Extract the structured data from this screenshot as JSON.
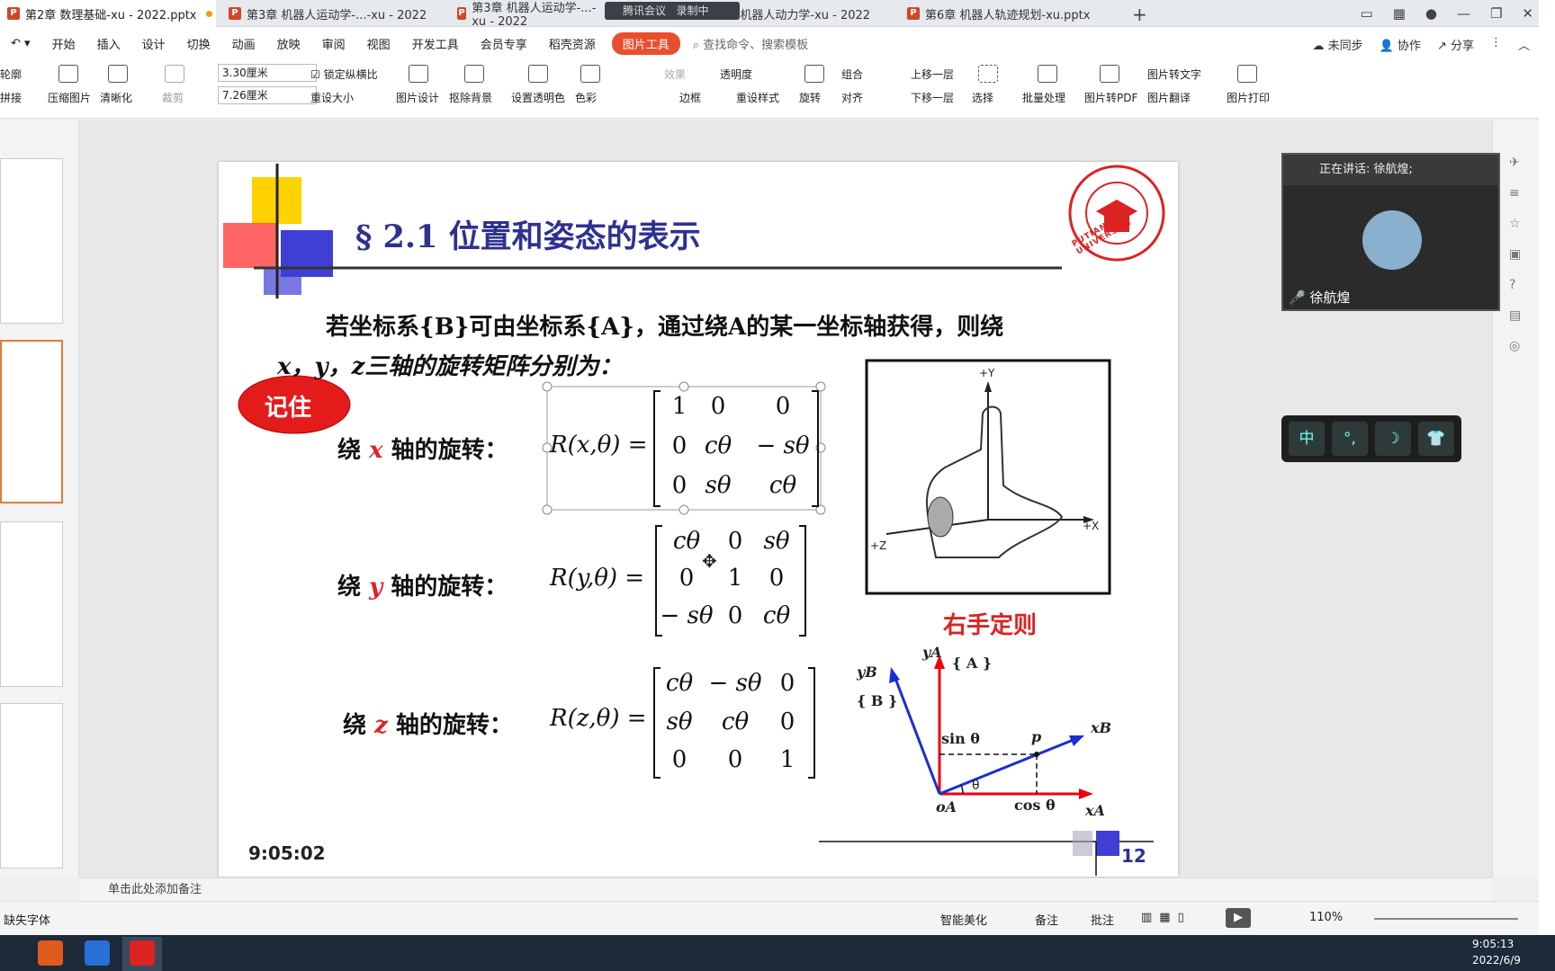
{
  "tabs": [
    {
      "label": "第2章 数理基础-xu - 2022.pptx",
      "active": true
    },
    {
      "label": "第3章 机器人运动学-...-xu - 2022",
      "active": false
    },
    {
      "label": "第3章 机器人运动学-...-xu - 2022",
      "active": false
    },
    {
      "label": "第5章 机器人动力学-xu - 2022",
      "active": false
    },
    {
      "label": "第6章 机器人轨迹规划-xu.pptx",
      "active": false
    }
  ],
  "meeting": {
    "label": "腾讯会议",
    "recording": "录制中"
  },
  "menu": [
    "开始",
    "插入",
    "设计",
    "切换",
    "动画",
    "放映",
    "审阅",
    "视图",
    "开发工具",
    "会员专享",
    "稻壳资源"
  ],
  "menu_active": "图片工具",
  "search_placeholder": "查找命令、搜索模板",
  "menu_right": [
    "未同步",
    "协作",
    "分享"
  ],
  "ribbon": {
    "items": [
      "轮廓",
      "拼接",
      "压缩图片",
      "清晰化",
      "裁剪",
      "锁定纵横比",
      "重设大小",
      "图片设计",
      "抠除背景",
      "设置透明色",
      "色彩",
      "效果",
      "透明度",
      "边框",
      "重设样式",
      "旋转",
      "组合",
      "对齐",
      "上移一层",
      "下移一层",
      "选择",
      "批量处理",
      "图片转PDF",
      "图片转文字",
      "图片翻译",
      "图片打印"
    ],
    "width_value": "3.30厘米",
    "height_value": "7.26厘米"
  },
  "slide": {
    "title": "§ 2.1 位置和姿态的表示",
    "para1": "若坐标系{B}可由坐标系{A}，通过绕A的某一坐标轴获得，则绕",
    "para2": "x，y，z三轴的旋转矩阵分别为：",
    "badge": "记住",
    "rot_x": {
      "pre": "绕",
      "axis": "x",
      "post": "轴的旋转：",
      "lhs": "R(x,θ) =",
      "m": [
        [
          "1",
          "0",
          "0"
        ],
        [
          "0",
          "cθ",
          "− sθ"
        ],
        [
          "0",
          "sθ",
          "cθ"
        ]
      ]
    },
    "rot_y": {
      "pre": "绕",
      "axis": "y",
      "post": "轴的旋转：",
      "lhs": "R(y,θ) =",
      "m": [
        [
          "cθ",
          "0",
          "sθ"
        ],
        [
          "0",
          "1",
          "0"
        ],
        [
          "− sθ",
          "0",
          "cθ"
        ]
      ]
    },
    "rot_z": {
      "pre": "绕",
      "axis": "z",
      "post": "轴的旋转：",
      "lhs": "R(z,θ) =",
      "m": [
        [
          "cθ",
          "− sθ",
          "0"
        ],
        [
          "sθ",
          "cθ",
          "0"
        ],
        [
          "0",
          "0",
          "1"
        ]
      ]
    },
    "hand_caption": "右手定则",
    "hand_labels": {
      "y": "+Y",
      "x": "+X",
      "z": "+Z"
    },
    "diagram": {
      "yA": "yA",
      "yB": "yB",
      "A": "{ A }",
      "B": "{ B }",
      "sin": "sin θ",
      "cos": "cos θ",
      "p": "p",
      "xB": "xB",
      "xA": "xA",
      "oA": "oA",
      "theta": "θ"
    },
    "clock": "9:05:02",
    "page": "12",
    "university_text": "PUTIAN UNIVERSITY"
  },
  "video": {
    "speaking": "正在讲话: 徐航煌;",
    "name": "徐航煌"
  },
  "ime": [
    "中",
    "°,",
    "☽",
    "👕"
  ],
  "notes_placeholder": "单击此处添加备注",
  "status": {
    "missing_font": "缺失字体",
    "smart": "智能美化",
    "notes": "备注",
    "comments": "批注",
    "zoom": "110%"
  },
  "taskbar": {
    "time": "9:05:13",
    "date": "2022/6/9"
  }
}
